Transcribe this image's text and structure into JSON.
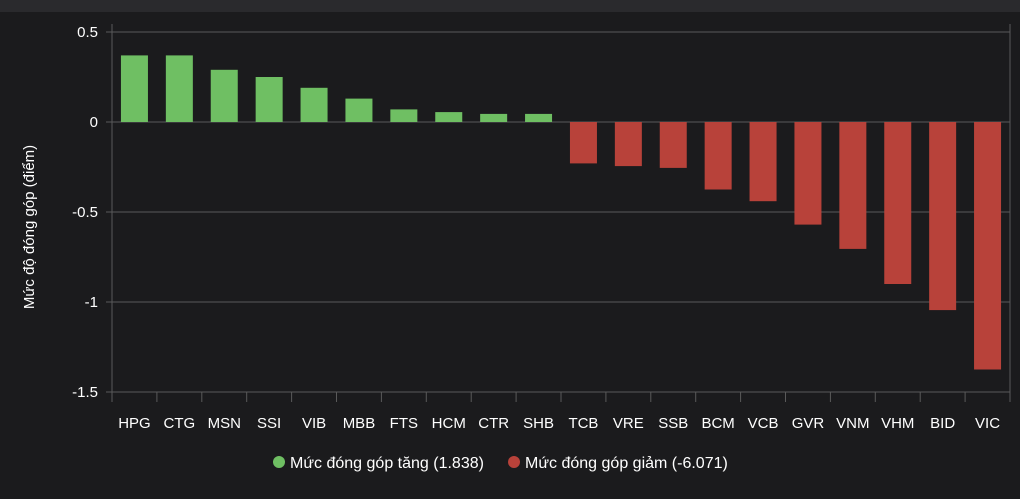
{
  "chart_data": {
    "type": "bar",
    "ylabel": "Mức độ đóng góp (điểm)",
    "ylim": [
      -1.5,
      0.5
    ],
    "y_ticks": [
      0.5,
      0,
      -0.5,
      -1,
      -1.5
    ],
    "y_tick_labels": [
      "0.5",
      "0",
      "-0.5",
      "-1",
      "-1.5"
    ],
    "grid": true,
    "legend_position": "bottom",
    "categories": [
      "HPG",
      "CTG",
      "MSN",
      "SSI",
      "VIB",
      "MBB",
      "FTS",
      "HCM",
      "CTR",
      "SHB",
      "TCB",
      "VRE",
      "SSB",
      "BCM",
      "VCB",
      "GVR",
      "VNM",
      "VHM",
      "BID",
      "VIC"
    ],
    "values": [
      0.37,
      0.37,
      0.29,
      0.25,
      0.19,
      0.13,
      0.07,
      0.055,
      0.045,
      0.045,
      -0.23,
      -0.245,
      -0.255,
      -0.375,
      -0.44,
      -0.57,
      -0.705,
      -0.9,
      -1.045,
      -1.375
    ],
    "series": [
      {
        "name": "Mức đóng góp tăng (1.838)",
        "color": "#6fbf63",
        "categories": [
          "HPG",
          "CTG",
          "MSN",
          "SSI",
          "VIB",
          "MBB",
          "FTS",
          "HCM",
          "CTR",
          "SHB"
        ]
      },
      {
        "name": "Mức đóng góp giảm (-6.071)",
        "color": "#b8423a",
        "categories": [
          "TCB",
          "VRE",
          "SSB",
          "BCM",
          "VCB",
          "GVR",
          "VNM",
          "VHM",
          "BID",
          "VIC"
        ]
      }
    ],
    "colors": {
      "background": "#1b1b1d",
      "grid": "#5a5a5a",
      "text": "#ffffff"
    }
  }
}
